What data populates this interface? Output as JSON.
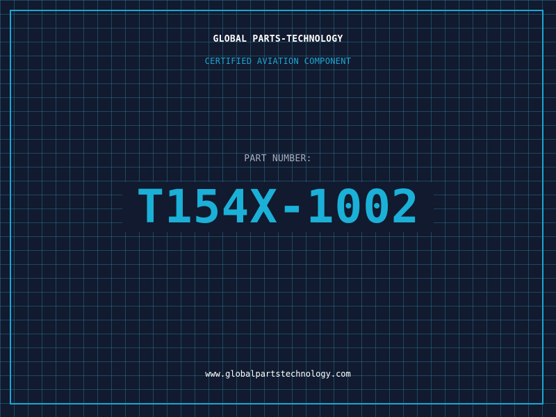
{
  "header": {
    "company": "GLOBAL PARTS-TECHNOLOGY",
    "tagline": "CERTIFIED AVIATION COMPONENT"
  },
  "part": {
    "label": "PART NUMBER:",
    "number": "T154X-1002"
  },
  "footer": {
    "website": "www.globalpartstechnology.com"
  },
  "colors": {
    "background": "#111a2e",
    "accent": "#1aa7d6",
    "grid": "#286e8c"
  }
}
